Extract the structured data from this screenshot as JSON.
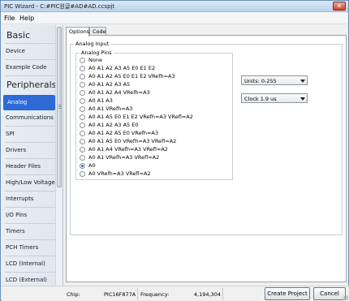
{
  "window": {
    "title": "PIC Wizard - C:#PIC원글#AD#AD.ccspjt",
    "close_label": "✕"
  },
  "menu": [
    "File",
    "Help"
  ],
  "sidebar": {
    "heading_basic": "Basic",
    "basic_items": [
      "Device",
      "Example Code"
    ],
    "heading_peripherals": "Peripherals",
    "peripheral_items": [
      "Analog",
      "Communications",
      "SPI",
      "Drivers",
      "Header Files",
      "High/Low Voltage",
      "Interrupts",
      "I/O Pins",
      "Timers",
      "PCH Timers",
      "LCD (Internal)",
      "LCD (External)"
    ],
    "active_item": "Analog"
  },
  "tabs": [
    {
      "label": "Options",
      "active": true
    },
    {
      "label": "Code",
      "active": false
    }
  ],
  "analog_input": {
    "group_label": "Analog Input",
    "pins_label": "Analog Pins",
    "pins": [
      "None",
      "A0 A1 A2 A3 A5 E0 E1 E2",
      "A0 A1 A2 A5 E0 E1 E2 VRefh=A3",
      "A0 A1 A2 A3 A5",
      "A0 A1 A2 A4 VRefh=A3",
      "A0 A1 A3",
      "A0 A1 VRefh=A3",
      "A0 A1 A5 E0 E1 E2 VRefh=A3 VRefl=A2",
      "A0 A1 A2 A3 A5 E0",
      "A0 A1 A2 A5 E0 VRefh=A3",
      "A0 A1 A5 E0 VRefh=A3 VRefl=A2",
      "A0 A1 A4 VRefh=A3 VRefl=A2",
      "A0 A1 VRefh=A3 VRefl=A2",
      "A0",
      "A0 VRefh=A3 VRefl=A2"
    ],
    "selected_pin": "A0",
    "units_value": "Units: 0-255",
    "clock_value": "Clock 1.9 us"
  },
  "status": {
    "chip_label": "Chip:",
    "chip_value": "PIC16F877A",
    "frequency_label": "Frequency:",
    "frequency_value": "4,194,304",
    "create_button": "Create Project",
    "cancel_button": "Cancel"
  }
}
